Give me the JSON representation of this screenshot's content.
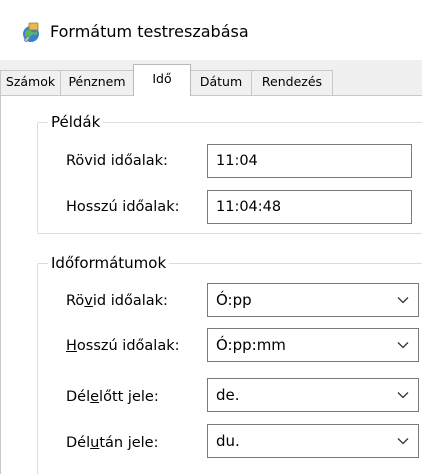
{
  "window": {
    "title": "Formátum testreszabása",
    "icon": "control-panel-region-icon"
  },
  "tabs": [
    {
      "label": "Számok",
      "active": false
    },
    {
      "label": "Pénznem",
      "active": false
    },
    {
      "label": "Idő",
      "active": true
    },
    {
      "label": "Dátum",
      "active": false
    },
    {
      "label": "Rendezés",
      "active": false
    }
  ],
  "examples": {
    "group_label": "Példák",
    "short_label": "Rövid időalak:",
    "short_value": "11:04",
    "long_label": "Hosszú időalak:",
    "long_value": "11:04:48"
  },
  "formats": {
    "group_label": "Időformátumok",
    "short_label_pre": "Rö",
    "short_label_u": "v",
    "short_label_post": "id időalak:",
    "short_value": "Ó:pp",
    "long_label_pre": "",
    "long_label_u": "H",
    "long_label_post": "osszú időalak:",
    "long_value": "Ó:pp:mm",
    "am_label_pre": "Dél",
    "am_label_u": "e",
    "am_label_post": "lőtt jele:",
    "am_value": "de.",
    "pm_label_pre": "Dél",
    "pm_label_u": "u",
    "pm_label_post": "tán jele:",
    "pm_value": "du."
  }
}
